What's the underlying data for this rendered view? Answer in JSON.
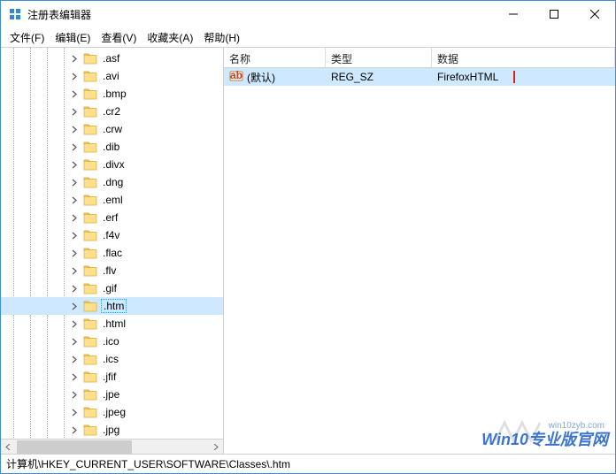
{
  "window": {
    "title": "注册表编辑器"
  },
  "menu": {
    "file": "文件(F)",
    "edit": "编辑(E)",
    "view": "查看(V)",
    "favorites": "收藏夹(A)",
    "help": "帮助(H)"
  },
  "tree": {
    "items": [
      {
        "label": ".asf",
        "selected": false
      },
      {
        "label": ".avi",
        "selected": false
      },
      {
        "label": ".bmp",
        "selected": false
      },
      {
        "label": ".cr2",
        "selected": false
      },
      {
        "label": ".crw",
        "selected": false
      },
      {
        "label": ".dib",
        "selected": false
      },
      {
        "label": ".divx",
        "selected": false
      },
      {
        "label": ".dng",
        "selected": false
      },
      {
        "label": ".eml",
        "selected": false
      },
      {
        "label": ".erf",
        "selected": false
      },
      {
        "label": ".f4v",
        "selected": false
      },
      {
        "label": ".flac",
        "selected": false
      },
      {
        "label": ".flv",
        "selected": false
      },
      {
        "label": ".gif",
        "selected": false
      },
      {
        "label": ".htm",
        "selected": true
      },
      {
        "label": ".html",
        "selected": false
      },
      {
        "label": ".ico",
        "selected": false
      },
      {
        "label": ".ics",
        "selected": false
      },
      {
        "label": ".jfif",
        "selected": false
      },
      {
        "label": ".jpe",
        "selected": false
      },
      {
        "label": ".jpeg",
        "selected": false
      },
      {
        "label": ".jpg",
        "selected": false
      }
    ]
  },
  "list": {
    "columns": {
      "name": "名称",
      "type": "类型",
      "data": "数据"
    },
    "rows": [
      {
        "name": "(默认)",
        "type": "REG_SZ",
        "data": "FirefoxHTML",
        "selected": true,
        "highlighted": true
      }
    ]
  },
  "status": {
    "path": "计算机\\HKEY_CURRENT_USER\\SOFTWARE\\Classes\\.htm"
  },
  "watermark": {
    "main": "Win10专业版官网",
    "sub": "win10zyb.com"
  }
}
